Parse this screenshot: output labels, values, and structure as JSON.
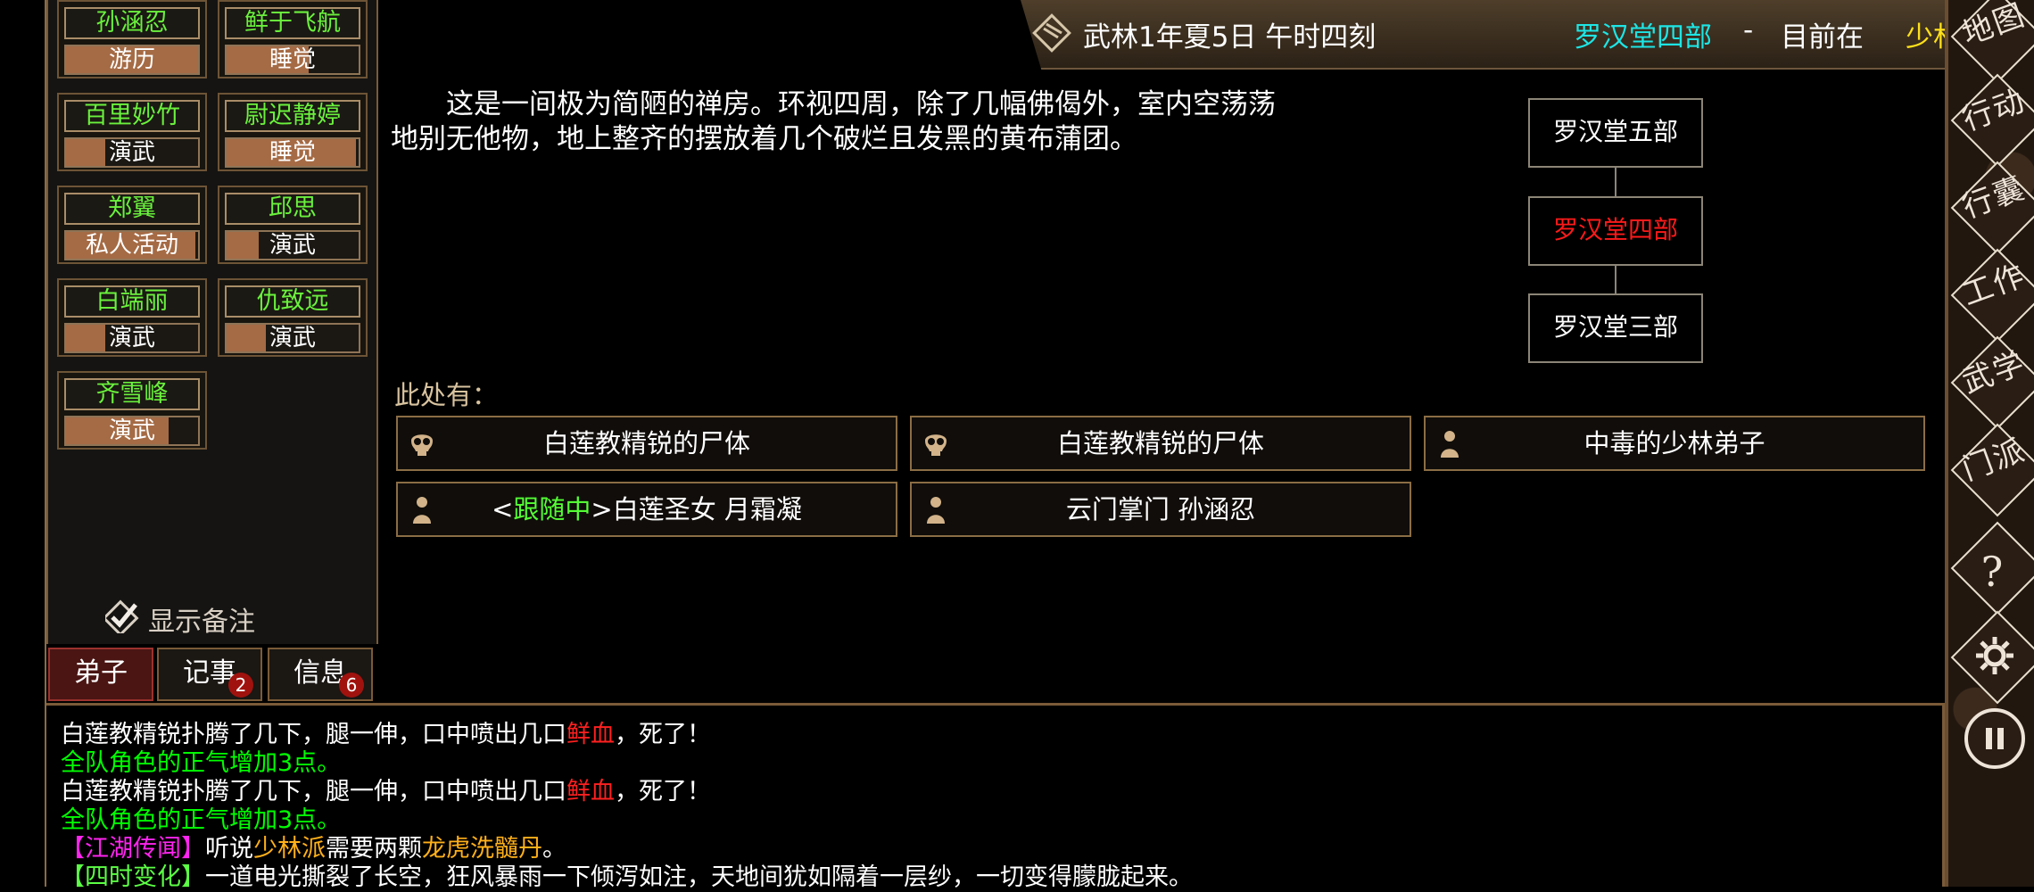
{
  "members": [
    {
      "name": "孙涵忍",
      "status": "游历",
      "fill": 1.0
    },
    {
      "name": "鲜于飞航",
      "status": "睡觉",
      "fill": 0.62
    },
    {
      "name": "百里妙竹",
      "status": "演武",
      "fill": 0.3
    },
    {
      "name": "尉迟静婷",
      "status": "睡觉",
      "fill": 0.98
    },
    {
      "name": "郑翼",
      "status": "私人活动",
      "fill": 0.98
    },
    {
      "name": "邱思",
      "status": "演武",
      "fill": 0.24
    },
    {
      "name": "白端丽",
      "status": "演武",
      "fill": 0.3
    },
    {
      "name": "仇致远",
      "status": "演武",
      "fill": 0.3
    },
    {
      "name": "齐雪峰",
      "status": "演武",
      "fill": 0.78
    }
  ],
  "note_toggle": "显示备注",
  "tabs": [
    {
      "label": "弟子"
    },
    {
      "label": "记事",
      "badge": "2"
    },
    {
      "label": "信息",
      "badge": "6"
    }
  ],
  "header": {
    "date": "武林1年夏5日 午时四刻",
    "current": "罗汉堂四部",
    "dash": "-",
    "prefix": "目前在",
    "temple": "少林寺"
  },
  "description": "　　这是一间极为简陋的禅房。环视四周，除了几幅佛偈外，室内空荡荡地别无他物，地上整齐的摆放着几个破烂且发黑的黄布蒲团。",
  "map": {
    "north": "罗汉堂五部",
    "current": "罗汉堂四部",
    "south": "罗汉堂三部"
  },
  "here_label": "此处有：",
  "entities": [
    {
      "icon": "skull-icon",
      "text": "白莲教精锐的尸体"
    },
    {
      "icon": "skull-icon",
      "text": "白莲教精锐的尸体"
    },
    {
      "icon": "person-icon",
      "text": "中毒的少林弟子"
    },
    {
      "icon": "person-icon",
      "prefix": "<",
      "follow": "跟随中",
      "suffix": ">白莲圣女 月霜凝"
    },
    {
      "icon": "person-icon",
      "text": "云门掌门 孙涵忍"
    }
  ],
  "log": {
    "line1_a": "白莲教精锐扑腾了几下，腿一伸，口中喷出几口",
    "line1_b": "鲜血",
    "line1_c": "，死了！",
    "line2": "全队角色的正气增加3点。",
    "line3_a": "白莲教精锐扑腾了几下，腿一伸，口中喷出几口",
    "line3_b": "鲜血",
    "line3_c": "，死了！",
    "line4": "全队角色的正气增加3点。",
    "line5_tag": "【江湖传闻】",
    "line5_a": "听说",
    "line5_b": "少林派",
    "line5_c": "需要两颗",
    "line5_d": "龙虎洗髓丹",
    "line5_e": "。",
    "line6_tag": "【四时变化】",
    "line6_text": "一道电光撕裂了长空，狂风暴雨一下倾泻如注，天地间犹如隔着一层纱，一切变得朦胧起来。"
  },
  "right_menu": [
    "地图",
    "行动",
    "行囊",
    "工作",
    "武学",
    "门派",
    "?",
    "settings-icon",
    "pause-icon"
  ],
  "colors": {
    "member_name": "#6af13d",
    "status_fill": "#a56b45",
    "location": "#1de5e5",
    "temple": "#ffe11a",
    "follow": "#54ff35",
    "blood": "#ff2020",
    "log_green": "#00ff00",
    "rumor": "#ff24ef",
    "highlight": "#ffb01a"
  }
}
